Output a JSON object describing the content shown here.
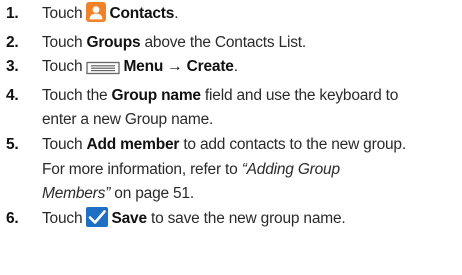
{
  "steps": [
    {
      "number": "1.",
      "lines": [
        {
          "t1": "Touch ",
          "icon": "contacts-app-icon",
          "b1": "Contacts",
          "t2": "."
        }
      ]
    },
    {
      "number": "2.",
      "lines": [
        {
          "t1": "Touch ",
          "b1": "Groups",
          "t2": " above the Contacts List."
        }
      ]
    },
    {
      "number": "3.",
      "lines": [
        {
          "t1": "Touch ",
          "icon": "menu-key-icon",
          "b1": "Menu → Create",
          "t2": "."
        }
      ]
    },
    {
      "number": "4.",
      "lines": [
        {
          "t1": "Touch the ",
          "b1": "Group name",
          "t2": " field and use the keyboard to"
        },
        {
          "t1": "enter a new Group name."
        }
      ]
    },
    {
      "number": "5.",
      "lines": [
        {
          "t1": "Touch ",
          "b1": "Add member",
          "t2": " to add contacts to the new group."
        },
        {
          "t1": "For more information, refer to ",
          "i1": "“Adding Group"
        },
        {
          "i1": "Members”",
          "t2": " on page 51."
        }
      ]
    },
    {
      "number": "6.",
      "lines": [
        {
          "t1": "Touch ",
          "icon": "save-check-icon",
          "b1": "Save",
          "t2": " to save the new group name."
        }
      ]
    }
  ],
  "colors": {
    "contacts_icon_bg": "#f0822a",
    "save_icon_bg": "#1f6fc4",
    "menu_icon": "#666666"
  }
}
